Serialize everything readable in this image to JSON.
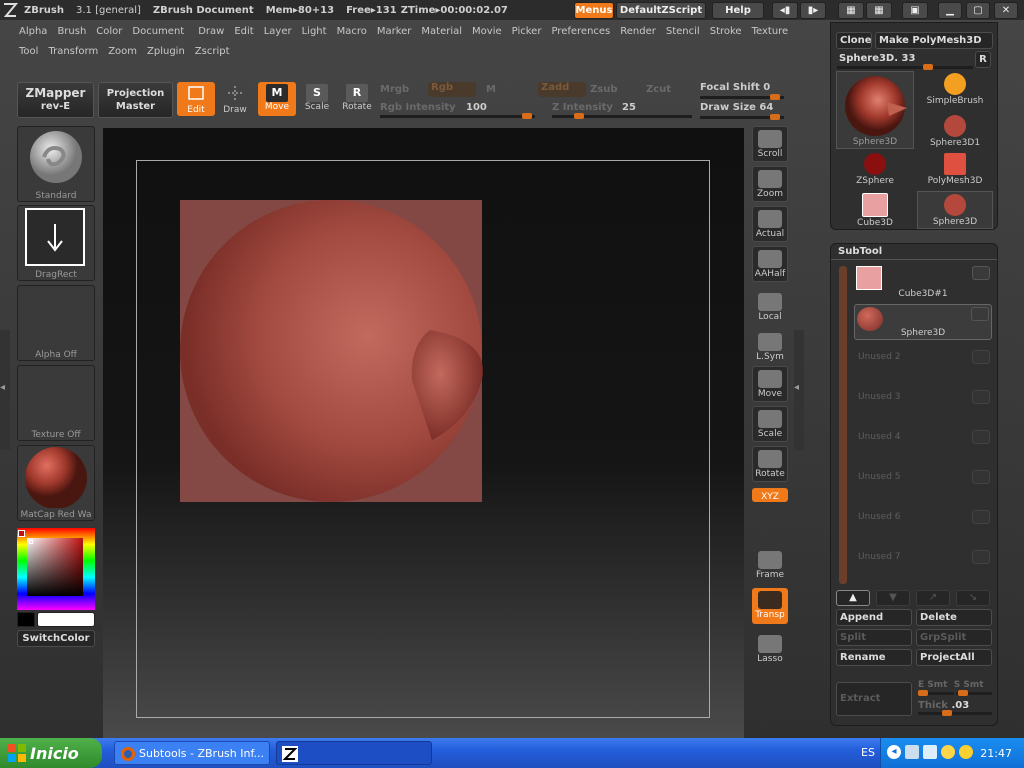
{
  "titlebar": {
    "app": "ZBrush",
    "version": "3.1 [general]",
    "document": "ZBrush Document",
    "mem": "Mem▸80+13",
    "free": "Free▸131",
    "ztime": "ZTime▸00:00:02.07",
    "menus_btn": "Menus",
    "script_btn": "DefaultZScript",
    "help_btn": "Help"
  },
  "menu_row1": [
    "Alpha",
    "Brush",
    "Color",
    "Document",
    "Draw",
    "Edit",
    "Layer",
    "Light",
    "Macro",
    "Marker",
    "Material",
    "Movie",
    "Picker",
    "Preferences",
    "Render",
    "Stencil",
    "Stroke",
    "Texture"
  ],
  "menu_row2": [
    "Tool",
    "Transform",
    "Zoom",
    "Zplugin",
    "Zscript"
  ],
  "toolbar": {
    "zmapper_line1": "ZMapper",
    "zmapper_line2": "rev-E",
    "projection_line1": "Projection",
    "projection_line2": "Master",
    "edit": "Edit",
    "draw": "Draw",
    "move": "Move",
    "scale": "Scale",
    "rotate": "Rotate",
    "mrgb": "Mrgb",
    "rgb": "Rgb",
    "m": "M",
    "zadd": "Zadd",
    "zsub": "Zsub",
    "zcut": "Zcut",
    "rgb_intensity_label": "Rgb Intensity",
    "rgb_intensity_value": "100",
    "z_intensity_label": "Z Intensity",
    "z_intensity_value": "25",
    "focal_shift_label": "Focal Shift",
    "focal_shift_value": "0",
    "draw_size_label": "Draw Size",
    "draw_size_value": "64"
  },
  "left_panel": {
    "brush_label": "Standard",
    "stroke_label": "DragRect",
    "alpha_label": "Alpha Off",
    "texture_label": "Texture Off",
    "material_label": "MatCap Red Wa",
    "switch_color": "SwitchColor"
  },
  "right_strip": [
    {
      "label": "Scroll",
      "icon": "scroll-icon",
      "box": true
    },
    {
      "label": "Zoom",
      "icon": "zoom-icon",
      "box": true
    },
    {
      "label": "Actual",
      "icon": "actual-icon",
      "box": true
    },
    {
      "label": "AAHalf",
      "icon": "aahalf-icon",
      "box": true
    },
    {
      "label": "Local",
      "icon": "local-icon",
      "box": false
    },
    {
      "label": "L.Sym",
      "icon": "lsym-icon",
      "box": false
    },
    {
      "label": "Move",
      "icon": "move-icon",
      "box": true
    },
    {
      "label": "Scale",
      "icon": "scale-icon",
      "box": true
    },
    {
      "label": "Rotate",
      "icon": "rotate-icon",
      "box": true
    },
    {
      "label": "XYZ",
      "icon": "xyz-icon",
      "box": false
    },
    {
      "label": "Frame",
      "icon": "frame-icon",
      "box": false
    },
    {
      "label": "Transp",
      "icon": "transp-icon",
      "box": false
    },
    {
      "label": "Lasso",
      "icon": "lasso-icon",
      "box": false
    }
  ],
  "tool_panel": {
    "clone": "Clone",
    "make_polymesh": "Make PolyMesh3D",
    "current_tool": "Sphere3D. 33",
    "r_btn": "R",
    "big_thumb_label": "Sphere3D",
    "items": [
      "SimpleBrush",
      "Sphere3D1",
      "ZSphere",
      "PolyMesh3D",
      "Cube3D",
      "Sphere3D"
    ]
  },
  "subtool": {
    "title": "SubTool",
    "rows": [
      {
        "label": "Cube3D#1",
        "unused": false
      },
      {
        "label": "Sphere3D",
        "unused": false
      },
      {
        "label": "Unused  2",
        "unused": true
      },
      {
        "label": "Unused  3",
        "unused": true
      },
      {
        "label": "Unused  4",
        "unused": true
      },
      {
        "label": "Unused  5",
        "unused": true
      },
      {
        "label": "Unused  6",
        "unused": true
      },
      {
        "label": "Unused  7",
        "unused": true
      }
    ],
    "append": "Append",
    "delete": "Delete",
    "split": "Split",
    "grpsplit": "GrpSplit",
    "rename": "Rename",
    "projectall": "ProjectAll",
    "extract": "Extract",
    "esmt": "E Smt",
    "ssmt": "S Smt",
    "thick_label": "Thick",
    "thick_value": ".03"
  },
  "taskbar": {
    "start": "Inicio",
    "task1": "Subtools - ZBrush Inf...",
    "lang": "ES",
    "clock": "21:47"
  },
  "colors": {
    "accent_orange": "#f07a1a",
    "model_red": "#a84a40",
    "taskbar_blue": "#245edb",
    "start_green": "#3a9d35"
  }
}
